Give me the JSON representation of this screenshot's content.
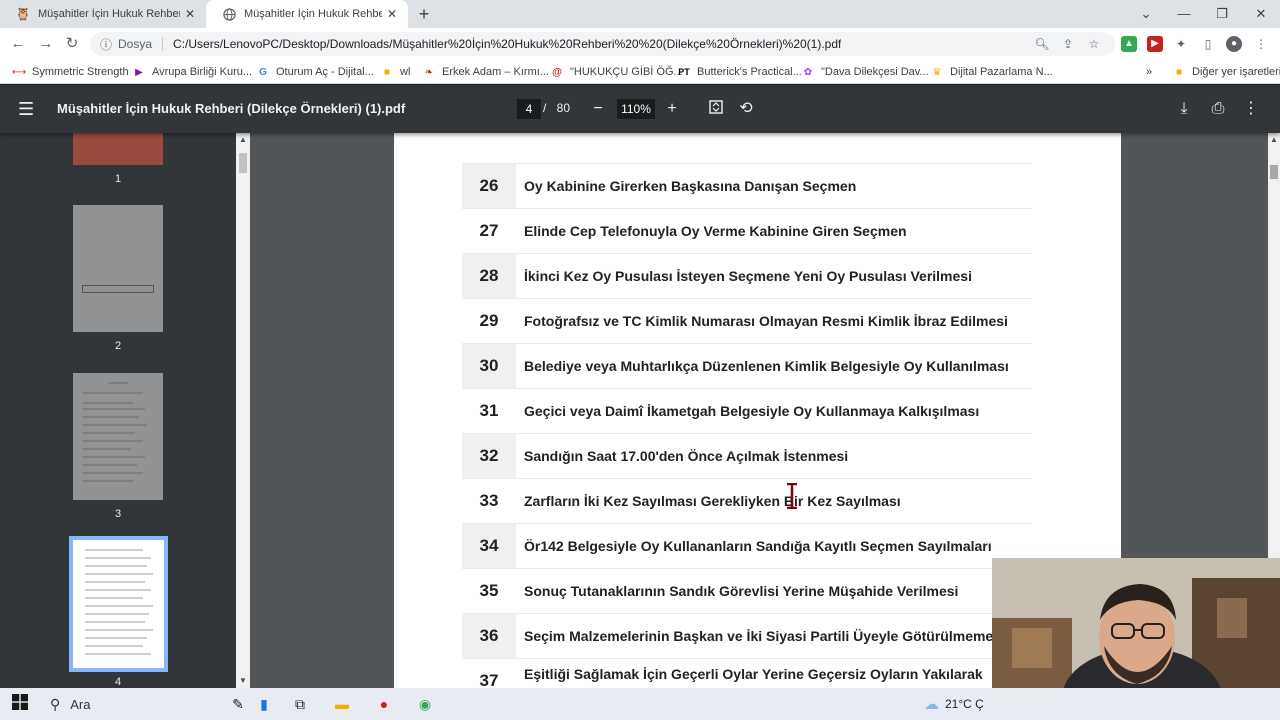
{
  "tabs": [
    {
      "title": "Müşahitler İçin Hukuk Rehberi (D",
      "active": false
    },
    {
      "title": "Müşahitler İçin Hukuk Rehberi (D",
      "active": true
    }
  ],
  "address": {
    "scheme": "Dosya",
    "url": "C:/Users/LenovoPC/Desktop/Downloads/Müşahitler%20İçin%20Hukuk%20Rehberi%20%20(Dilekçe%20Örnekleri)%20(1).pdf"
  },
  "bookmarks": [
    {
      "label": "Symmetric Strength",
      "color": "#d93025"
    },
    {
      "label": "Avrupa Birliği Kuru...",
      "color": "#7b1fa2"
    },
    {
      "label": "Oturum Aç - Dijital...",
      "color": "#4285f4"
    },
    {
      "label": "wl",
      "color": "#f9ab00"
    },
    {
      "label": "Erkek Adam – Kırmı...",
      "color": "#c5221f"
    },
    {
      "label": "\"HUKUKÇU GİBİ ÖĞ...",
      "color": "#c5221f"
    },
    {
      "label": "Butterick's Practical...",
      "color": "#000000"
    },
    {
      "label": "\"Dava Dilekçesi Dav...",
      "color": "#a142f4"
    },
    {
      "label": "Dijital Pazarlama N...",
      "color": "#f9ab00"
    }
  ],
  "bookmarks_more": "»",
  "bookmarks_other": "Diğer yer işaretleri",
  "pdf": {
    "title": "Müşahitler İçin Hukuk Rehberi (Dilekçe Örnekleri) (1).pdf",
    "current_page": "4",
    "separator": "/",
    "total_pages": "80",
    "zoom": "110%"
  },
  "thumbnails": [
    {
      "label": "1"
    },
    {
      "label": "2"
    },
    {
      "label": "3"
    },
    {
      "label": "4"
    }
  ],
  "rows": [
    {
      "num": "26",
      "text": "Oy Kabinine Girerken Başkasına Danışan Seçmen"
    },
    {
      "num": "27",
      "text": "Elinde Cep Telefonuyla Oy Verme Kabinine Giren Seçmen"
    },
    {
      "num": "28",
      "text": "İkinci Kez Oy Pusulası İsteyen Seçmene Yeni Oy Pusulası Verilmesi"
    },
    {
      "num": "29",
      "text": "Fotoğrafsız ve TC Kimlik Numarası Olmayan Resmi Kimlik İbraz Edilmesi"
    },
    {
      "num": "30",
      "text": "Belediye veya Muhtarlıkça Düzenlenen Kimlik Belgesiyle Oy Kullanılması"
    },
    {
      "num": "31",
      "text": "Geçici veya Daimî İkametgah Belgesiyle Oy Kullanmaya Kalkışılması"
    },
    {
      "num": "32",
      "text": "Sandığın Saat 17.00'den Önce Açılmak İstenmesi"
    },
    {
      "num": "33",
      "text": "Zarfların İki Kez Sayılması Gerekliyken Bir Kez Sayılması"
    },
    {
      "num": "34",
      "text": "Ör142 Belgesiyle Oy Kullananların Sandığa Kayıtlı Seçmen Sayılmaları"
    },
    {
      "num": "35",
      "text": "Sonuç Tutanaklarının Sandık Görevlisi Yerine Müşahide Verilmesi"
    },
    {
      "num": "36",
      "text": "Seçim Malzemelerinin Başkan ve İki Siyasi Partili Üyeyle Götürülmeme"
    },
    {
      "num": "37",
      "text": "Eşitliği Sağlamak İçin Geçerli Oylar Yerine Geçersiz Oyların Yakılarak"
    }
  ],
  "taskbar": {
    "search": "Ara",
    "weather": "21°C Ç"
  }
}
